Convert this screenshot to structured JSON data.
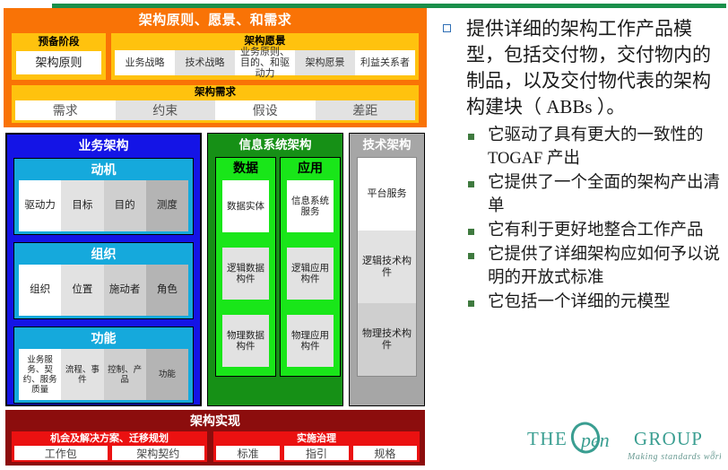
{
  "diagram": {
    "architecture_principles": {
      "title": "架构原则、愿景、和需求",
      "prelim": {
        "caption": "预备阶段",
        "item": "架构原则"
      },
      "vision": {
        "caption": "架构愿景",
        "items": [
          "业务战略",
          "技术战略",
          "业务原则、目的、和驱动力",
          "架构愿景",
          "利益关系者"
        ]
      },
      "requirements": {
        "caption": "架构需求",
        "items": [
          "需求",
          "约束",
          "假设",
          "差距"
        ]
      }
    },
    "business_architecture": {
      "title": "业务架构",
      "groups": [
        {
          "caption": "动机",
          "items": [
            "驱动力",
            "目标",
            "目的",
            "测度"
          ]
        },
        {
          "caption": "组织",
          "items": [
            "组织",
            "位置",
            "施动者",
            "角色"
          ]
        },
        {
          "caption": "功能",
          "items": [
            "业务服务、契约、服务质量",
            "流程、事件",
            "控制、产品",
            "功能"
          ]
        }
      ]
    },
    "information_systems_architecture": {
      "title": "信息系统架构",
      "columns": [
        {
          "caption": "数据",
          "items": [
            "数据实体",
            "逻辑数据构件",
            "物理数据构件"
          ]
        },
        {
          "caption": "应用",
          "items": [
            "信息系统服务",
            "逻辑应用构件",
            "物理应用构件"
          ]
        }
      ]
    },
    "technology_architecture": {
      "title": "技术架构",
      "items": [
        "平台服务",
        "逻辑技术构件",
        "物理技术构件"
      ]
    },
    "architecture_realization": {
      "title": "架构实现",
      "panels": [
        {
          "caption": "机会及解决方案、迁移规划",
          "items": [
            "工作包",
            "架构契约"
          ]
        },
        {
          "caption": "实施治理",
          "items": [
            "标准",
            "指引",
            "规格"
          ]
        }
      ]
    }
  },
  "text_panel": {
    "main_bullet": "提供详细的架构工作产品模型，包括交付物，交付物内的制品，以及交付物代表的架构构建块（ ABBs ）。",
    "sub_bullets": [
      "它驱动了具有更大的一致性的TOGAF 产出",
      "它提供了一个全面的架构产出清单",
      "它有利于更好地整合工作产品",
      "它提供了详细架构应如何予以说明的开放式标准",
      "它包括一个详细的元模型"
    ]
  },
  "logo": {
    "word_the": "THE",
    "word_open": "pen",
    "word_group": "GROUP",
    "tagline": "Making standards work",
    "registered": "®"
  },
  "colors": {
    "orange": "#F97306",
    "yellow": "#FFC20E",
    "blue": "#1414E6",
    "cyan": "#15A9DC",
    "dark_green": "#169016",
    "bright_green": "#19E619",
    "gray": "#A6A6A6",
    "dark_red": "#8C0D0D",
    "red": "#EB1111",
    "rule_green": "#1A8F4A",
    "logo_teal": "#2E9B8F"
  }
}
